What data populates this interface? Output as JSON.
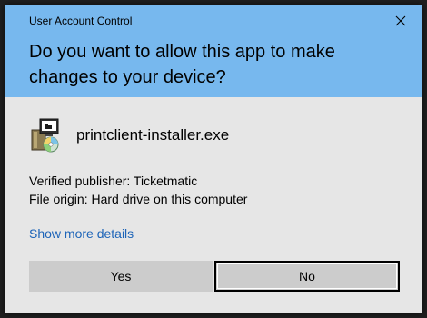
{
  "window": {
    "title": "User Account Control",
    "question": "Do you want to allow this app to make changes to your device?"
  },
  "app": {
    "name": "printclient-installer.exe",
    "icon": "installer-package-icon"
  },
  "details": {
    "publisher": "Verified publisher: Ticketmatic",
    "origin": "File origin: Hard drive on this computer"
  },
  "link": {
    "show_more": "Show more details"
  },
  "buttons": {
    "yes": "Yes",
    "no": "No"
  },
  "colors": {
    "header": "#77b8ee",
    "body": "#e6e6e6",
    "button": "#cccccc",
    "link": "#1d64b8",
    "border": "#2c7fd8"
  }
}
